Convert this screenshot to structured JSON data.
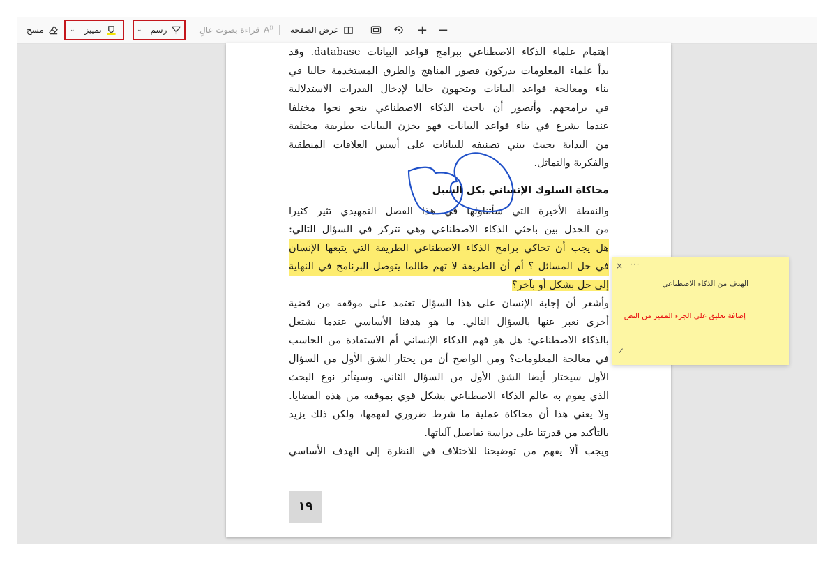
{
  "toolbar": {
    "erase_label": "مسح",
    "highlight_label": "تمييز",
    "draw_label": "رسم",
    "read_aloud_label": "قراءة بصوت عالٍ",
    "page_view_label": "عرض الصفحة",
    "zoom_in": "+",
    "zoom_out": "−",
    "highlight_color": "#f2e300",
    "accent_red": "#c4161c"
  },
  "document": {
    "lines_top": [
      "اهتمام علماء الذكاء الاصطناعي ببرامج قواعد البيانات database. وقد",
      "بدأ علماء المعلومات يدركون قصور المناهج والطرق المستخدمة حاليا في",
      "بناء ومعالجة قواعد البيانات ويتجهون حاليا لإدخال القدرات الاستدلالية",
      "في برامجهم. وأتصور أن باحث الذكاء الاصطناعي ينحو نحوا مختلفا",
      "عندما يشرع في بناء قواعد البيانات فهو يخزن البيانات بطريقة مختلفة",
      "من البداية بحيث يبني تصنيفه للبيانات على أسس العلاقات المنطقية",
      "والفكرية والتماثل."
    ],
    "heading": "محاكاة السلوك الإنساني بكل السبل",
    "lines_mid": [
      "والنقطة الأخيرة التي سأتناولها في هذا الفصل التمهيدي تثير كثيرا",
      "من الجدل بين باحثي الذكاء الاصطناعي وهي تتركز في السؤال التالي:"
    ],
    "lines_highlighted": [
      "هل يجب أن تحاكي برامج الذكاء الاصطناعي الطريقة التي يتبعها الإنسان",
      "في حل المسائل ؟ أم أن الطريقة لا تهم طالما يتوصل البرنامج في النهاية",
      "إلى حل بشكل أو بآخر؟"
    ],
    "lines_bottom": [
      "وأشعر أن إجابة الإنسان على هذا السؤال تعتمد على موقفه من قضية",
      "أخرى نعبر عنها بالسؤال التالي. ما هو هدفنا الأساسي عندما نشتغل",
      "بالذكاء الاصطناعي: هل هو فهم الذكاء الإنساني أم الاستفادة من الحاسب",
      "في معالجة المعلومات؟ ومن الواضح أن من يختار الشق الأول من السؤال",
      "الأول سيختار أيضا الشق الأول من السؤال الثاني. وسيتأثر نوع البحث",
      "الذي يقوم به عالم الذكاء الاصطناعي بشكل قوي بموقفه من هذه القضايا.",
      "ولا يعني هذا أن محاكاة عملية ما شرط ضروري لفهمها، ولكن ذلك يزيد",
      "بالتأكيد من قدرتنا على دراسة تفاصيل آلياتها.",
      "ويجب ألا يفهم من توضيحنا للاختلاف في النظرة إلى الهدف الأساسي"
    ],
    "page_number": "١٩",
    "ink_color": "#1f50c8"
  },
  "note": {
    "title": "الهدف من الذكاء الاصطناعي",
    "body": "إضافة تعليق على الجزء المميز من النص",
    "close": "×",
    "more": "···",
    "check": "✓",
    "background": "#fdf6a3",
    "body_color": "#e81010"
  }
}
